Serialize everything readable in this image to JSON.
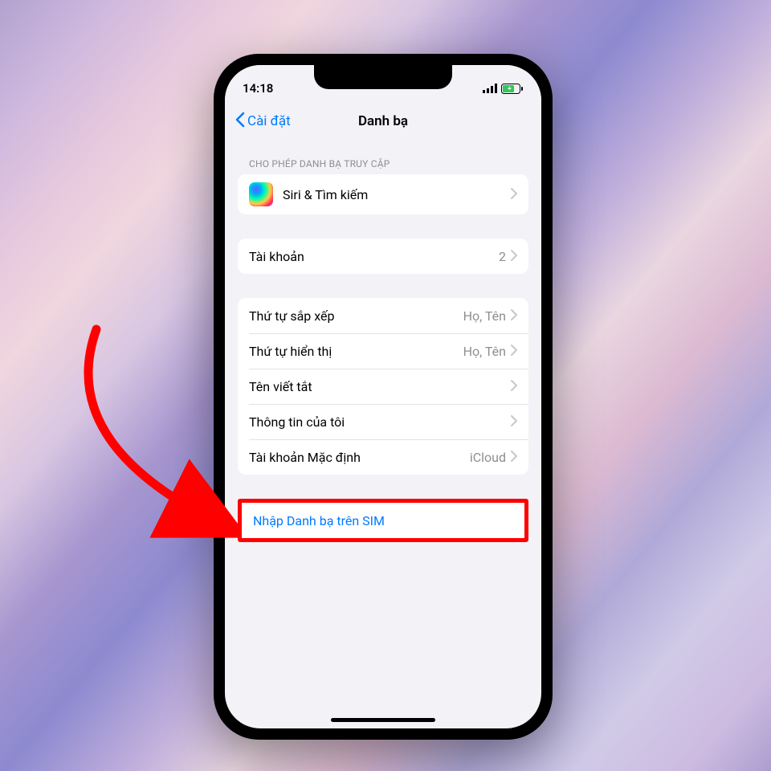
{
  "statusbar": {
    "time": "14:18"
  },
  "nav": {
    "back": "Cài đặt",
    "title": "Danh bạ"
  },
  "sections": {
    "access_header": "CHO PHÉP DANH BẠ TRUY CẬP",
    "siri": "Siri & Tìm kiếm",
    "accounts": {
      "label": "Tài khoản",
      "value": "2"
    },
    "sort": {
      "label": "Thứ tự sắp xếp",
      "value": "Họ, Tên"
    },
    "display": {
      "label": "Thứ tự hiển thị",
      "value": "Họ, Tên"
    },
    "shortname": {
      "label": "Tên viết tắt"
    },
    "myinfo": {
      "label": "Thông tin của tôi"
    },
    "default_account": {
      "label": "Tài khoản Mặc định",
      "value": "iCloud"
    },
    "import_sim": "Nhập Danh bạ trên SIM"
  }
}
